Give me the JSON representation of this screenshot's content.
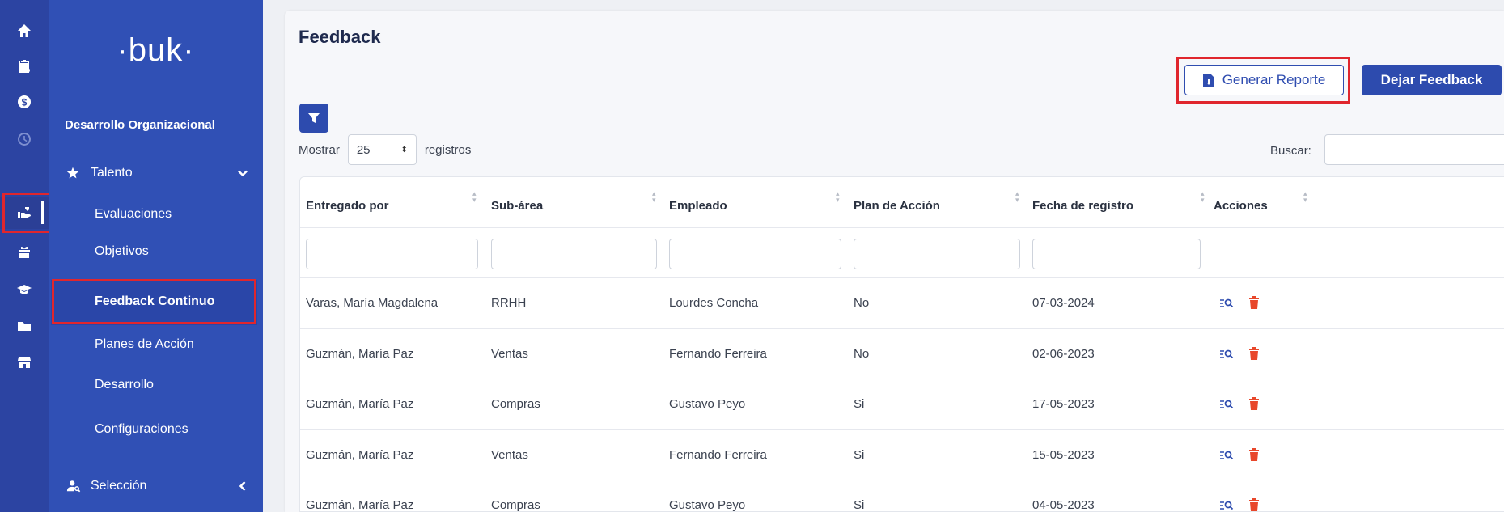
{
  "app": {
    "logo": "·buk·",
    "company": "Desarrollo Organizacional"
  },
  "rail": {
    "icons": [
      "home-icon",
      "clipboard-icon",
      "dollar-icon",
      "clock-icon",
      "hand-icon",
      "gift-icon",
      "graduation-cap-icon",
      "folder-icon",
      "store-icon"
    ]
  },
  "menu": {
    "section": "Talento",
    "items": [
      "Evaluaciones",
      "Objetivos",
      "Feedback Continuo",
      "Planes de Acción",
      "Desarrollo",
      "Configuraciones"
    ],
    "active": "Feedback Continuo",
    "next_section": "Selección"
  },
  "page": {
    "title": "Feedback",
    "generate_report": "Generar Reporte",
    "leave_feedback": "Dejar Feedback",
    "show_label": "Mostrar",
    "page_size": "25",
    "records_label": "registros",
    "search_label": "Buscar:"
  },
  "table": {
    "columns": [
      "Entregado por",
      "Sub-área",
      "Empleado",
      "Plan de Acción",
      "Fecha de registro",
      "Acciones"
    ],
    "rows": [
      [
        "Varas, María Magdalena",
        "RRHH",
        "Lourdes Concha",
        "No",
        "07-03-2024"
      ],
      [
        "Guzmán, María Paz",
        "Ventas",
        "Fernando Ferreira",
        "No",
        "02-06-2023"
      ],
      [
        "Guzmán, María Paz",
        "Compras",
        "Gustavo Peyo",
        "Si",
        "17-05-2023"
      ],
      [
        "Guzmán, María Paz",
        "Ventas",
        "Fernando Ferreira",
        "Si",
        "15-05-2023"
      ],
      [
        "Guzmán, María Paz",
        "Compras",
        "Gustavo Peyo",
        "Si",
        "04-05-2023"
      ]
    ]
  },
  "colors": {
    "primary": "#2d4bae",
    "sidebar": "#3050b5",
    "rail": "#2c44a2",
    "highlight": "#e0262d",
    "delete": "#e8472b"
  }
}
